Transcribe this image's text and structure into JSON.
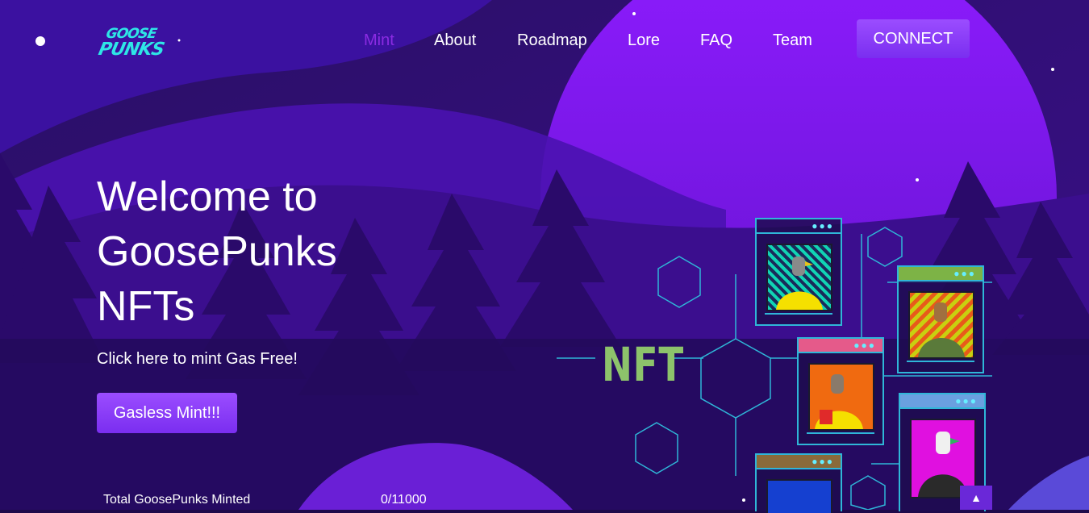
{
  "logo": {
    "line1": "GOOSE",
    "line2": "PUNKS"
  },
  "nav": {
    "items": [
      {
        "label": "Mint",
        "active": true
      },
      {
        "label": "About",
        "active": false
      },
      {
        "label": "Roadmap",
        "active": false
      },
      {
        "label": "Lore",
        "active": false
      },
      {
        "label": "FAQ",
        "active": false
      },
      {
        "label": "Team",
        "active": false
      }
    ],
    "connect_label": "CONNECT"
  },
  "hero": {
    "title_line1": "Welcome to",
    "title_line2": "GoosePunks",
    "title_line3": "NFTs",
    "subtitle": "Click here to mint Gas Free!",
    "mint_button": "Gasless Mint!!!"
  },
  "minted": {
    "label": "Total GoosePunks Minted",
    "value": "0/11000"
  },
  "illustration": {
    "badge_text": "NFT"
  },
  "colors": {
    "accent": "#8a2be2",
    "button": "#8b3dfa",
    "nft_green": "#8dc36b",
    "circuit": "#2fb6d8"
  }
}
